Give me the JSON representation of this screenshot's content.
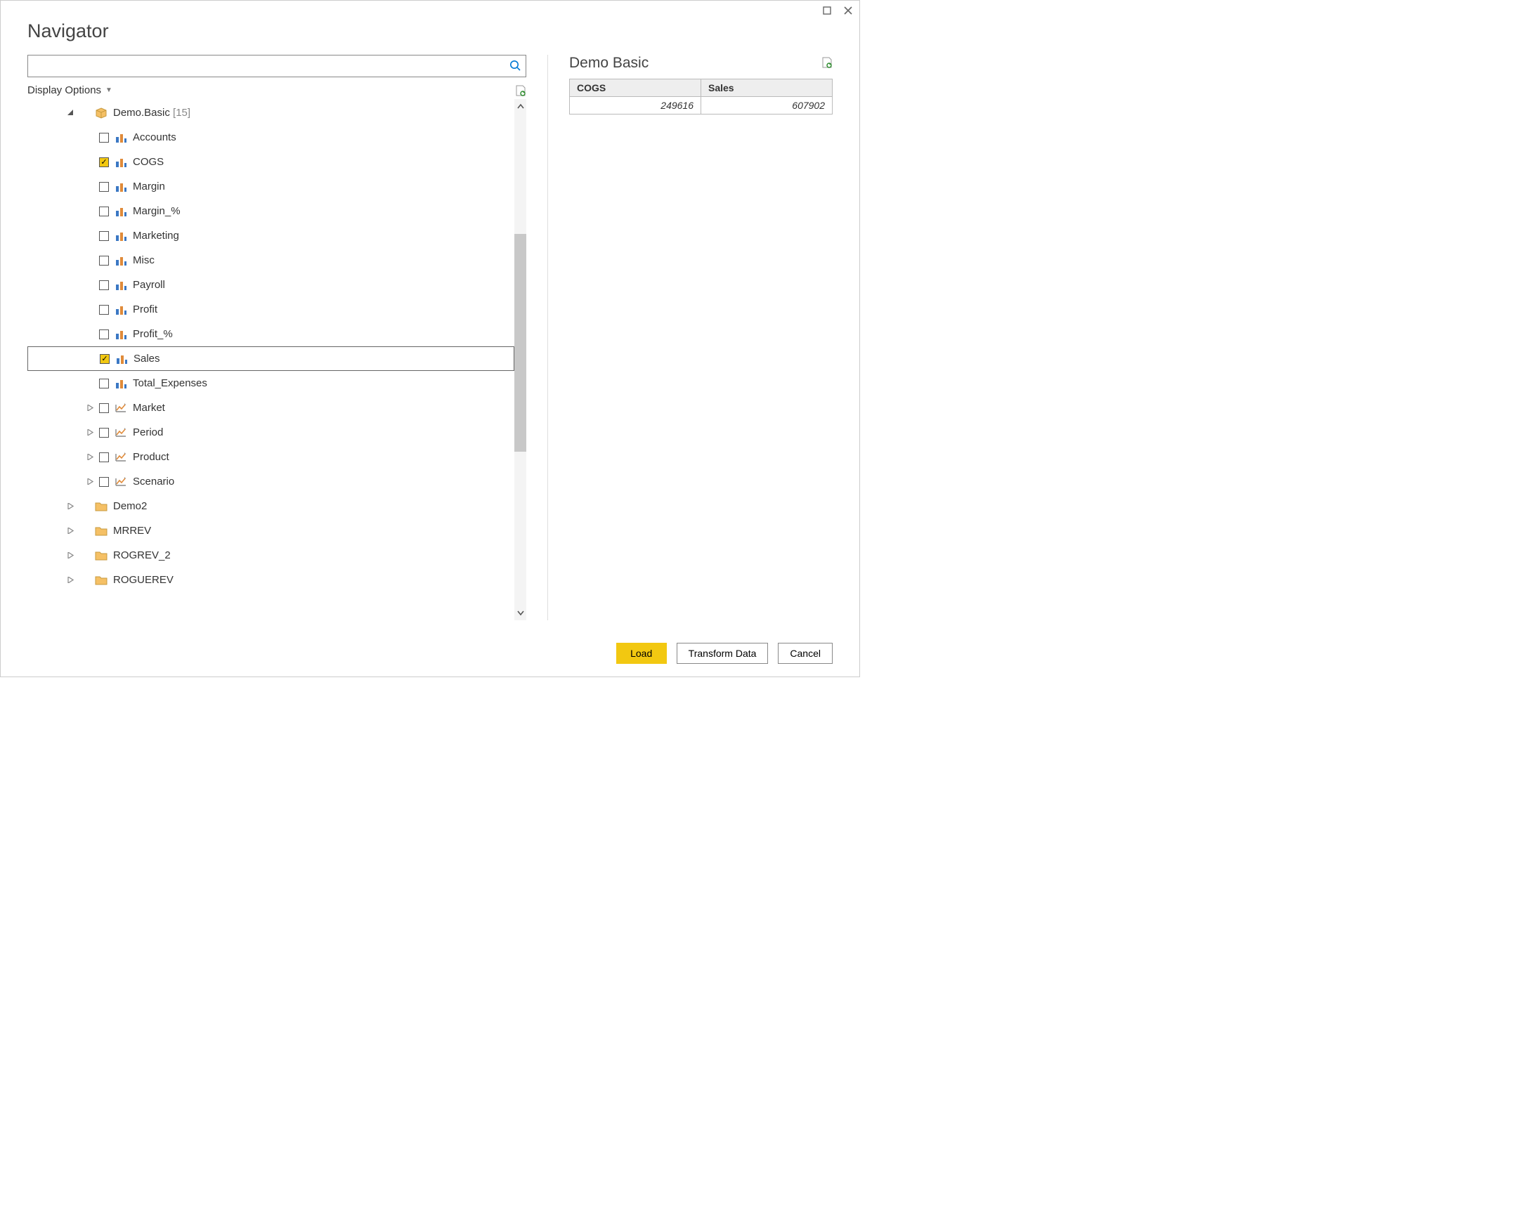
{
  "window": {
    "title": "Navigator",
    "maximize_tip": "Maximize",
    "close_tip": "Close"
  },
  "search": {
    "placeholder": ""
  },
  "display_options_label": "Display Options",
  "tree": {
    "root": {
      "label": "Demo.Basic",
      "count_suffix": "[15]",
      "expanded": true,
      "icon": "cube",
      "children": [
        {
          "label": "Accounts",
          "checked": false,
          "icon": "measure"
        },
        {
          "label": "COGS",
          "checked": true,
          "icon": "measure"
        },
        {
          "label": "Margin",
          "checked": false,
          "icon": "measure"
        },
        {
          "label": "Margin_%",
          "checked": false,
          "icon": "measure"
        },
        {
          "label": "Marketing",
          "checked": false,
          "icon": "measure"
        },
        {
          "label": "Misc",
          "checked": false,
          "icon": "measure"
        },
        {
          "label": "Payroll",
          "checked": false,
          "icon": "measure"
        },
        {
          "label": "Profit",
          "checked": false,
          "icon": "measure"
        },
        {
          "label": "Profit_%",
          "checked": false,
          "icon": "measure"
        },
        {
          "label": "Sales",
          "checked": true,
          "icon": "measure",
          "selected": true
        },
        {
          "label": "Total_Expenses",
          "checked": false,
          "icon": "measure"
        },
        {
          "label": "Market",
          "checked": false,
          "icon": "dim",
          "expandable": true
        },
        {
          "label": "Period",
          "checked": false,
          "icon": "dim",
          "expandable": true
        },
        {
          "label": "Product",
          "checked": false,
          "icon": "dim",
          "expandable": true
        },
        {
          "label": "Scenario",
          "checked": false,
          "icon": "dim",
          "expandable": true
        }
      ]
    },
    "siblings": [
      {
        "label": "Demo2",
        "icon": "folder",
        "expandable": true
      },
      {
        "label": "MRREV",
        "icon": "folder",
        "expandable": true
      },
      {
        "label": "ROGREV_2",
        "icon": "folder",
        "expandable": true
      },
      {
        "label": "ROGUEREV",
        "icon": "folder",
        "expandable": true
      }
    ]
  },
  "preview": {
    "title": "Demo Basic",
    "columns": [
      "COGS",
      "Sales"
    ],
    "rows": [
      [
        "249616",
        "607902"
      ]
    ]
  },
  "buttons": {
    "load": "Load",
    "transform": "Transform Data",
    "cancel": "Cancel"
  }
}
